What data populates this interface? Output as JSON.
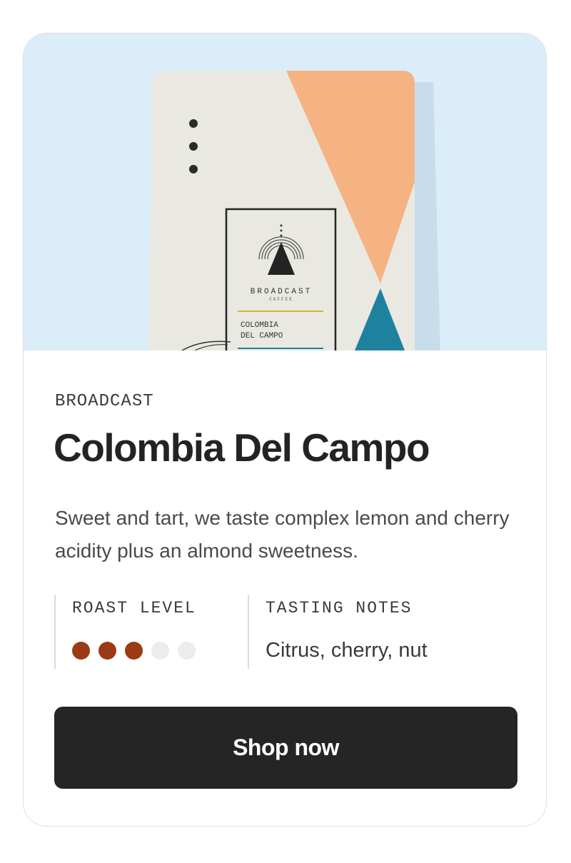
{
  "product": {
    "image": {
      "background_color": "#dbedf8",
      "bag_brand_text": "BROADCAST",
      "bag_brand_sub": "COFFEE",
      "bag_line1": "COLOMBIA",
      "bag_line2": "DEL CAMPO",
      "colors": {
        "bag": "#e9e9e2",
        "peach": "#f5b283",
        "teal": "#1e829f"
      }
    },
    "brand": "BROADCAST",
    "title": "Colombia Del Campo",
    "description": "Sweet and tart, we taste complex lemon and cherry acidity plus an almond sweetness.",
    "roast": {
      "label": "ROAST LEVEL",
      "level": 3,
      "max": 5,
      "filled_color": "#9b3a14",
      "empty_color": "#ececec"
    },
    "notes": {
      "label": "TASTING NOTES",
      "value": "Citrus, cherry, nut"
    },
    "cta": {
      "label": "Shop now"
    }
  }
}
